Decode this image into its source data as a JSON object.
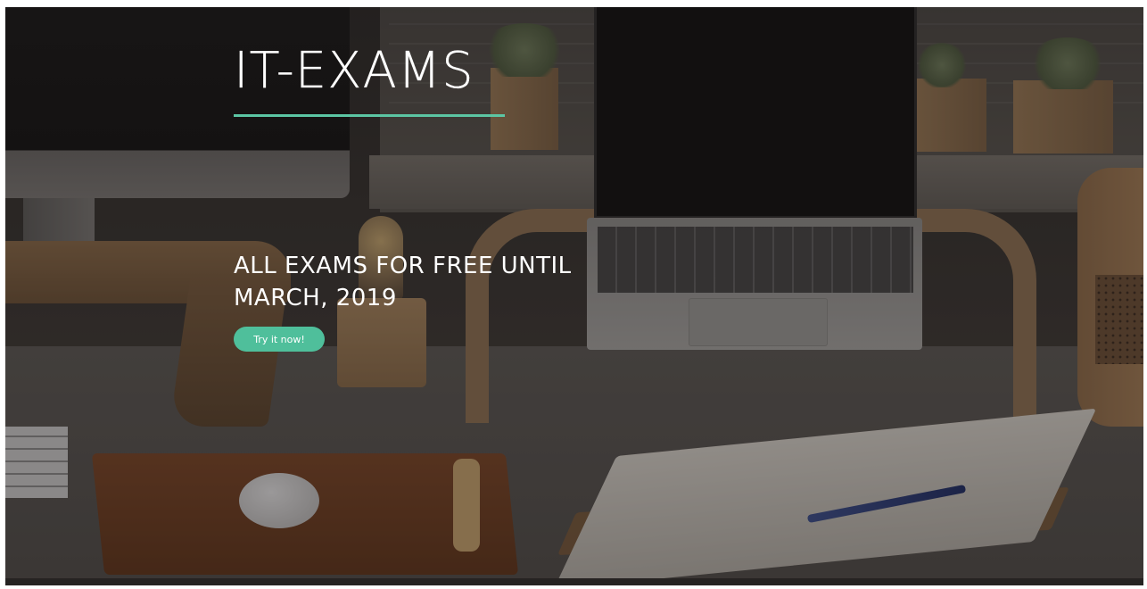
{
  "hero": {
    "brand": "IT-EXAMS",
    "headline": "ALL EXAMS FOR FREE UNTIL MARCH, 2019",
    "cta_label": "Try it now!"
  },
  "colors": {
    "accent": "#5cc6a4",
    "button": "#4fbf9b",
    "text": "#ffffff"
  }
}
